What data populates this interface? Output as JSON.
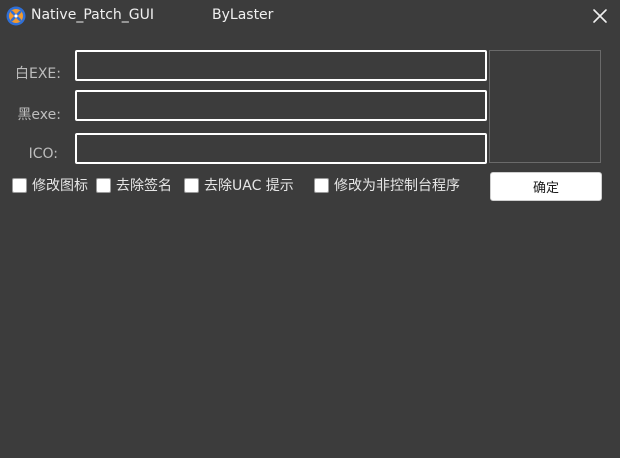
{
  "window": {
    "title": "Native_Patch_GUI",
    "author": "ByLaster"
  },
  "fields": [
    {
      "label": "白EXE:",
      "value": "",
      "placeholder": ""
    },
    {
      "label": "黑exe:",
      "value": "",
      "placeholder": ""
    },
    {
      "label": "ICO:",
      "value": "",
      "placeholder": ""
    }
  ],
  "options": [
    {
      "label": "修改图标",
      "checked": false
    },
    {
      "label": "去除签名",
      "checked": false
    },
    {
      "label": "去除UAC 提示",
      "checked": false
    },
    {
      "label": "修改为非控制台程序",
      "checked": false
    }
  ],
  "confirm_label": "确定",
  "colors": {
    "background": "#3c3c3c",
    "input_border": "#ffffff",
    "app_icon_blue": "#2f6fd6",
    "app_icon_orange": "#f29a2e"
  }
}
